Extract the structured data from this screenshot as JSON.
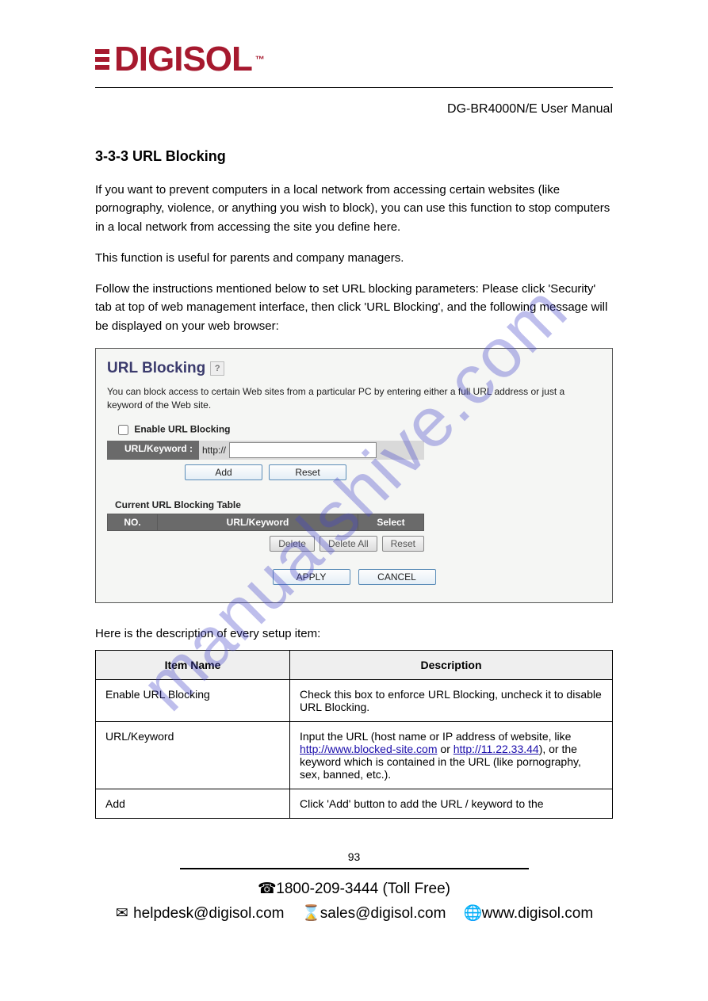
{
  "logo_text": "DIGISOL",
  "logo_tm": "™",
  "doc_title": "DG-BR4000N/E User Manual",
  "section_heading": "3-3-3 URL Blocking",
  "intro_para": "If you want to prevent computers in a local network from accessing certain websites (like pornography, violence, or anything you wish to block), you can use this function to stop computers in a local network from accessing the site you define here.",
  "intro_para2": "This function is useful for parents and company managers.",
  "follow_text": "Follow the instructions mentioned below to set URL blocking parameters: Please click 'Security' tab at top of web management interface, then click 'URL Blocking', and the following message will be displayed on your web browser:",
  "screenshot": {
    "title": "URL Blocking",
    "description": "You can block access to certain Web sites from a particular PC by entering either a full URL address or just a keyword of the Web site.",
    "enable_label": "Enable URL Blocking",
    "url_label": "URL/Keyword :",
    "http_prefix": "http://",
    "add_btn": "Add",
    "reset_btn": "Reset",
    "table_caption": "Current URL Blocking Table",
    "col_no": "NO.",
    "col_url": "URL/Keyword",
    "col_select": "Select",
    "delete_btn": "Delete",
    "delete_all_btn": "Delete All",
    "reset2_btn": "Reset",
    "apply_btn": "APPLY",
    "cancel_btn": "CANCEL"
  },
  "desc_intro": "Here is the description of every setup item:",
  "table": {
    "head_item": "Item Name",
    "head_desc": "Description",
    "rows": [
      {
        "item": "Enable URL Blocking",
        "desc_pre": "Check this box to enforce URL Blocking, uncheck it to disable URL Blocking.",
        "link": "",
        "desc_post": ""
      },
      {
        "item": "URL/Keyword",
        "desc_pre": "Input the URL (host name or IP address of website, like ",
        "link": "http://www.blocked-site.com",
        "desc_mid": " or ",
        "link2": "http://11.22.33.44",
        "desc_post": "), or the keyword which is contained in the URL (like pornography, sex, banned, etc.)."
      },
      {
        "item": "Add",
        "desc_pre": "Click 'Add' button to add the URL / keyword to the",
        "link": "",
        "desc_post": ""
      }
    ]
  },
  "page_number": "93",
  "footer": {
    "phone": "1800-209-3444 (Toll Free)",
    "helpdesk": "helpdesk@digisol.com",
    "sales": "sales@digisol.com",
    "web": "www.digisol.com"
  },
  "watermark": "manualshive.com"
}
